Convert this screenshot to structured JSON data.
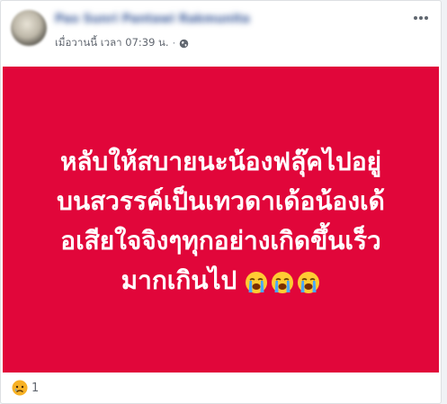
{
  "post": {
    "author_name": "Pao Sunri Pantawi Rakmunita",
    "timestamp": "เมื่อวานนี้ เวลา 07:39 น.",
    "separator": "·",
    "privacy_icon": "globe-icon",
    "text_lines": [
      "หลับให้สบายนะน้องฟลุ๊คไปอยู่",
      "บนสวรรค์เป็นเทวดาเด้อน้องเด้",
      "อเสียใจจิงๆทุกอย่างเกิดขึ้นเร็ว",
      "มากเกินไป"
    ],
    "emojis": [
      "loudly-crying-face",
      "loudly-crying-face",
      "loudly-crying-face"
    ],
    "background_color": "#e1063a"
  },
  "reactions": {
    "icon": "sad-reaction-icon",
    "count": "1"
  },
  "colors": {
    "accent": "#385898",
    "meta_text": "#616770",
    "post_bg": "#e1063a"
  }
}
